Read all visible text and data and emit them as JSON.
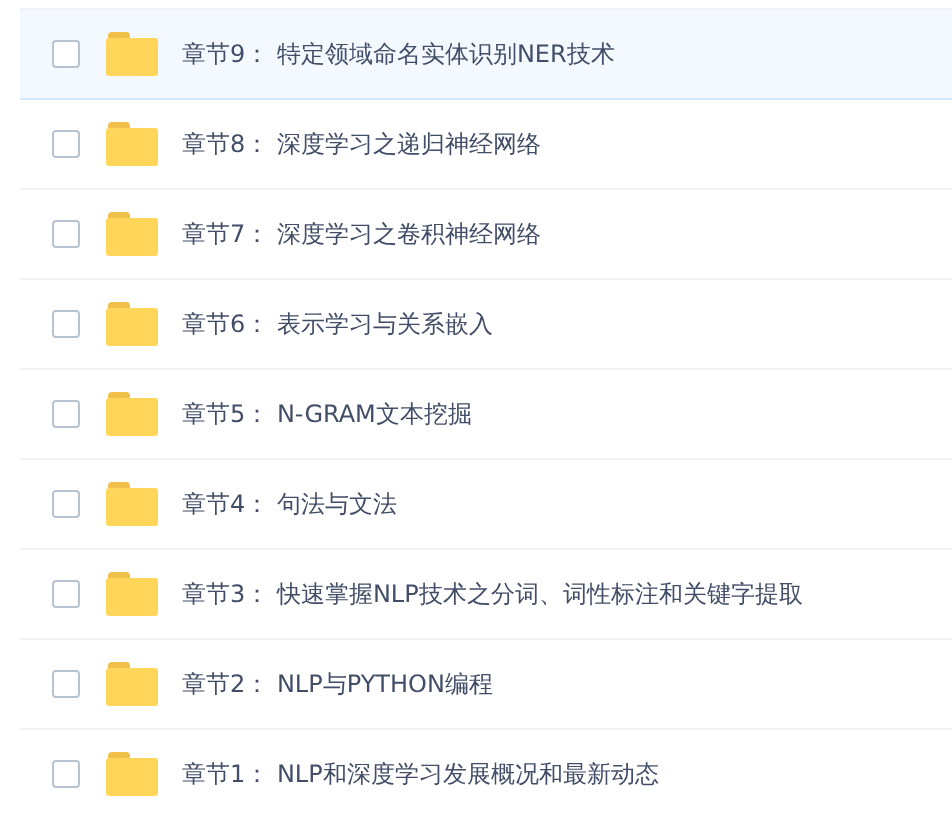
{
  "folders": [
    {
      "name": "章节9： 特定领域命名实体识别NER技术",
      "checked": false,
      "highlighted": true
    },
    {
      "name": "章节8： 深度学习之递归神经网络",
      "checked": false,
      "highlighted": false
    },
    {
      "name": "章节7： 深度学习之卷积神经网络",
      "checked": false,
      "highlighted": false
    },
    {
      "name": "章节6： 表示学习与关系嵌入",
      "checked": false,
      "highlighted": false
    },
    {
      "name": "章节5： N-GRAM文本挖掘",
      "checked": false,
      "highlighted": false
    },
    {
      "name": "章节4： 句法与文法",
      "checked": false,
      "highlighted": false
    },
    {
      "name": "章节3： 快速掌握NLP技术之分词、词性标注和关键字提取",
      "checked": false,
      "highlighted": false
    },
    {
      "name": "章节2： NLP与PYTHON编程",
      "checked": false,
      "highlighted": false
    },
    {
      "name": "章节1： NLP和深度学习发展概况和最新动态",
      "checked": false,
      "highlighted": false
    }
  ]
}
